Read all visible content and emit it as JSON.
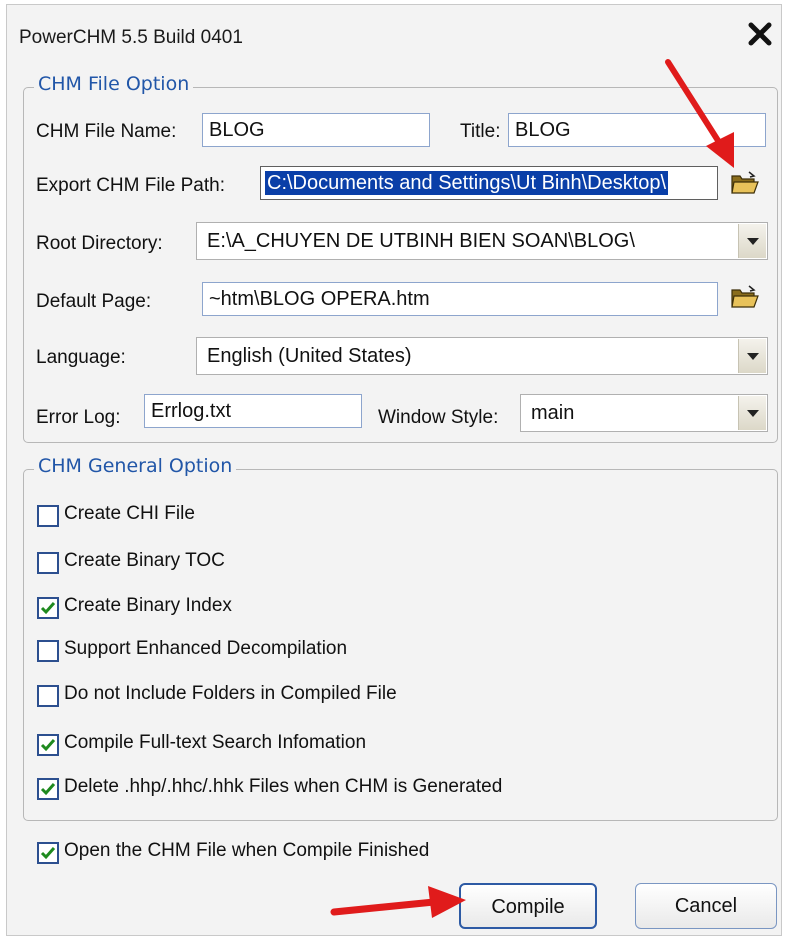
{
  "window": {
    "title": "PowerCHM 5.5 Build 0401"
  },
  "file_option": {
    "legend": "CHM File Option",
    "chm_file_name_label": "CHM File Name:",
    "chm_file_name_value": "BLOG",
    "title_label": "Title:",
    "title_value": "BLOG",
    "export_path_label": "Export CHM File Path:",
    "export_path_value": "C:\\Documents and Settings\\Ut Binh\\Desktop\\",
    "root_dir_label": "Root Directory:",
    "root_dir_value": "E:\\A_CHUYEN DE UTBINH BIEN SOAN\\BLOG\\",
    "default_page_label": "Default Page:",
    "default_page_value": "~htm\\BLOG OPERA.htm",
    "language_label": "Language:",
    "language_value": "English (United States)",
    "error_log_label": "Error Log:",
    "error_log_value": "Errlog.txt",
    "window_style_label": "Window Style:",
    "window_style_value": "main"
  },
  "general_option": {
    "legend": "CHM General Option",
    "items": [
      {
        "label": "Create CHI File",
        "checked": false
      },
      {
        "label": "Create Binary TOC",
        "checked": false
      },
      {
        "label": "Create Binary Index",
        "checked": true
      },
      {
        "label": "Support Enhanced Decompilation",
        "checked": false
      },
      {
        "label": "Do not Include Folders in Compiled File",
        "checked": false
      },
      {
        "label": "Compile Full-text Search Infomation",
        "checked": true
      },
      {
        "label": "Delete .hhp/.hhc/.hhk Files when CHM is Generated",
        "checked": true
      }
    ]
  },
  "open_when_finished": {
    "label": "Open the CHM File when Compile Finished",
    "checked": true
  },
  "buttons": {
    "compile": "Compile",
    "cancel": "Cancel"
  },
  "icons": {
    "close": "close-icon",
    "folder": "folder-open-icon",
    "dropdown": "chevron-down-icon",
    "check": "checkmark-icon"
  },
  "colors": {
    "legend": "#2156a8",
    "selection": "#0a3fa8",
    "annotation_arrow": "#e01b1b"
  }
}
